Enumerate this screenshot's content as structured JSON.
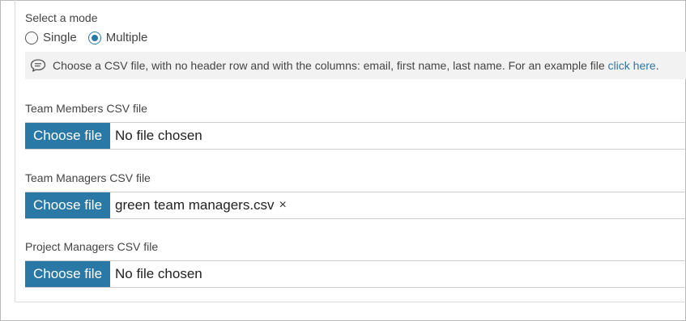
{
  "mode": {
    "label": "Select a mode",
    "options": [
      {
        "label": "Single",
        "selected": false
      },
      {
        "label": "Multiple",
        "selected": true
      }
    ]
  },
  "info": {
    "icon": "speech-bubble-icon",
    "text": "Choose a CSV file, with no header row and with the columns: email, first name, last name. For an example file ",
    "link": "click here",
    "suffix": "."
  },
  "fields": {
    "team_members": {
      "label": "Team Members CSV file",
      "button": "Choose file",
      "file": "No file chosen"
    },
    "team_managers": {
      "label": "Team Managers CSV file",
      "button": "Choose file",
      "file": "green team managers.csv",
      "clear_icon": "×"
    },
    "project_managers": {
      "label": "Project Managers CSV file",
      "button": "Choose file",
      "file": "No file chosen"
    }
  },
  "colors": {
    "accent": "#2a78a6",
    "info_bg": "#f2f2f2"
  }
}
